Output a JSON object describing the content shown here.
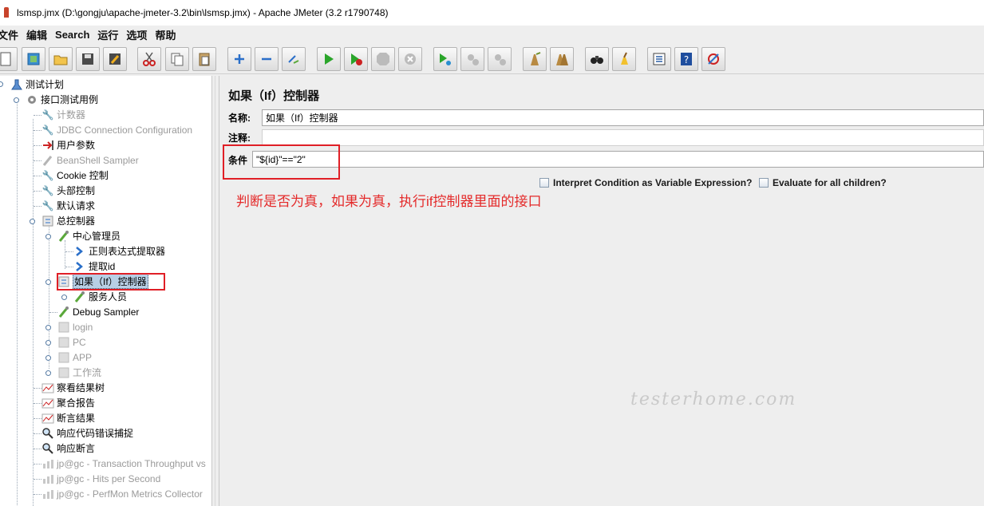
{
  "window": {
    "title": "lsmsp.jmx (D:\\gongju\\apache-jmeter-3.2\\bin\\lsmsp.jmx) - Apache JMeter (3.2 r1790748)"
  },
  "menu": [
    "文件",
    "编辑",
    "Search",
    "运行",
    "选项",
    "帮助"
  ],
  "toolbar": [
    "new-icon",
    "templates-icon",
    "open-icon",
    "save-icon",
    "save-as-icon",
    "cut-icon",
    "copy-icon",
    "paste-icon",
    "expand-icon",
    "collapse-icon",
    "toggle-icon",
    "start-icon",
    "start-no-pause-icon",
    "stop-icon",
    "shutdown-icon",
    "remote-start-icon",
    "remote-stop-icon",
    "remote-shutdown-icon",
    "clear-icon",
    "clear-all-icon",
    "search-icon",
    "reset-search-icon",
    "function-helper-icon",
    "help-icon",
    "plugins-icon"
  ],
  "tree": {
    "root": "测试计划",
    "group": "接口测试用例",
    "items": [
      {
        "label": "计数器",
        "disabled": true,
        "icon": "wrench-icon"
      },
      {
        "label": "JDBC Connection Configuration",
        "disabled": true,
        "icon": "wrench-icon"
      },
      {
        "label": "用户参数",
        "disabled": false,
        "icon": "pre-processor-icon"
      },
      {
        "label": "BeanShell Sampler",
        "disabled": true,
        "icon": "sampler-icon"
      },
      {
        "label": "Cookie 控制",
        "disabled": false,
        "icon": "wrench-icon"
      },
      {
        "label": "头部控制",
        "disabled": false,
        "icon": "wrench-icon"
      },
      {
        "label": "默认请求",
        "disabled": false,
        "icon": "wrench-icon"
      },
      {
        "label": "总控制器",
        "disabled": false,
        "icon": "controller-icon"
      },
      {
        "label": "中心管理员",
        "disabled": false,
        "icon": "sampler-icon"
      },
      {
        "label": "正则表达式提取器",
        "disabled": false,
        "icon": "post-processor-icon"
      },
      {
        "label": "提取id",
        "disabled": false,
        "icon": "post-processor-icon"
      },
      {
        "label": "如果（If）控制器",
        "disabled": false,
        "icon": "controller-icon"
      },
      {
        "label": "服务人员",
        "disabled": false,
        "icon": "sampler-icon"
      },
      {
        "label": "Debug Sampler",
        "disabled": false,
        "icon": "sampler-icon"
      },
      {
        "label": "login",
        "disabled": true,
        "icon": "controller-icon"
      },
      {
        "label": "PC",
        "disabled": true,
        "icon": "controller-icon"
      },
      {
        "label": "APP",
        "disabled": true,
        "icon": "controller-icon"
      },
      {
        "label": "工作流",
        "disabled": true,
        "icon": "controller-icon"
      },
      {
        "label": "察看结果树",
        "disabled": false,
        "icon": "listener-icon"
      },
      {
        "label": "聚合报告",
        "disabled": false,
        "icon": "listener-icon"
      },
      {
        "label": "断言结果",
        "disabled": false,
        "icon": "listener-icon"
      },
      {
        "label": "响应代码错误捕捉",
        "disabled": false,
        "icon": "assertion-icon"
      },
      {
        "label": "响应断言",
        "disabled": false,
        "icon": "assertion-icon"
      },
      {
        "label": "jp@gc - Transaction Throughput vs",
        "disabled": true,
        "icon": "graph-icon"
      },
      {
        "label": "jp@gc - Hits per Second",
        "disabled": true,
        "icon": "graph-icon"
      },
      {
        "label": "jp@gc - PerfMon Metrics Collector",
        "disabled": true,
        "icon": "graph-icon"
      }
    ]
  },
  "panel": {
    "title": "如果（If）控制器",
    "name_label": "名称:",
    "name_value": "如果（If）控制器",
    "comment_label": "注释:",
    "comment_value": "",
    "condition_label": "条件",
    "condition_value": "\"${id}\"==\"2\"",
    "check1": "Interpret Condition as Variable Expression?",
    "check2": "Evaluate for all children?",
    "annotation": "判断是否为真，如果为真，执行if控制器里面的接口"
  },
  "watermark": "testerhome.com",
  "colors": {
    "highlight_red": "#e01f26",
    "selection": "#b8cfe5"
  }
}
